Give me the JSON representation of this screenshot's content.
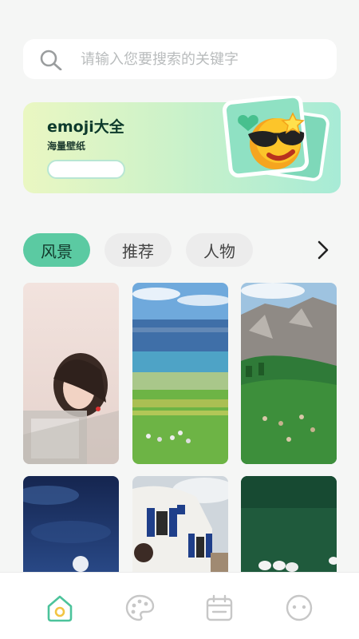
{
  "search": {
    "placeholder": "请输入您要搜索的关键字"
  },
  "banner": {
    "title": "emoji大全",
    "subtitle": "海量壁纸"
  },
  "tabs": [
    {
      "label": "风景",
      "active": true
    },
    {
      "label": "推荐",
      "active": false
    },
    {
      "label": "人物",
      "active": false
    }
  ],
  "colors": {
    "accent": "#5bcaa2",
    "background": "#f5f6f5",
    "nav_active": "#4cc39b",
    "nav_inactive": "#c7c7c7"
  },
  "grid": [
    {
      "name": "portrait-girl-image"
    },
    {
      "name": "lake-meadow-image"
    },
    {
      "name": "mountain-pasture-image"
    },
    {
      "name": "night-sky-moon-image"
    },
    {
      "name": "white-house-image"
    },
    {
      "name": "green-field-geese-image"
    }
  ],
  "nav": [
    {
      "icon": "home-icon",
      "active": true
    },
    {
      "icon": "palette-icon",
      "active": false
    },
    {
      "icon": "calendar-icon",
      "active": false
    },
    {
      "icon": "emoji-face-icon",
      "active": false
    }
  ]
}
